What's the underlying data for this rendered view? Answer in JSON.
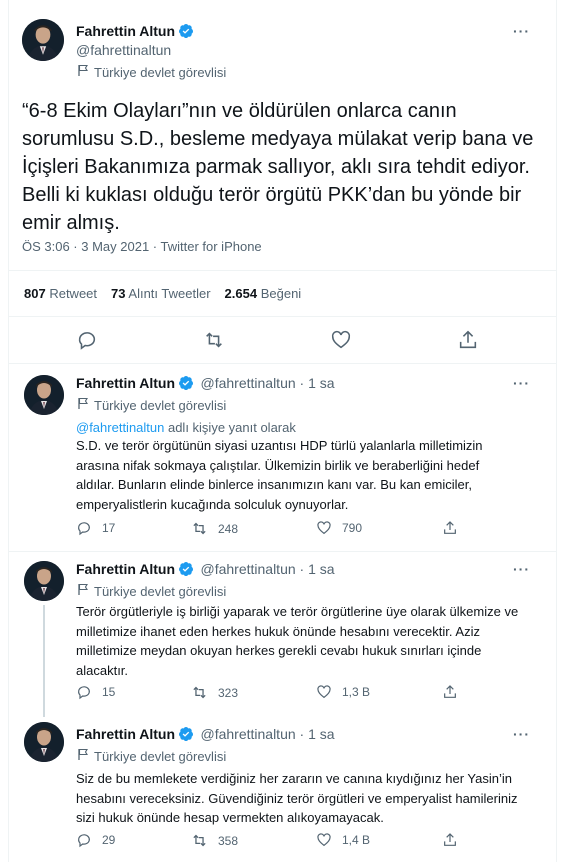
{
  "author": {
    "name": "Fahrettin Altun",
    "handle": "@fahrettinaltun",
    "label": "Türkiye devlet görevlisi"
  },
  "main_tweet": {
    "text": "“6-8 Ekim Olayları”nın ve öldürülen onlarca canın sorumlusu S.D., besleme medyaya mülakat verip bana ve İçişleri Bakanımıza parmak sallıyor, aklı sıra tehdit ediyor. Belli ki kuklası olduğu terör örgütü PKK’dan bu yönde bir emir almış.",
    "meta": "ÖS 3:06 · 3 May 2021 · Twitter for iPhone",
    "stats": {
      "retweets_count": "807",
      "retweets_label": "Retweet",
      "quotes_count": "73",
      "quotes_label": "Alıntı Tweetler",
      "likes_count": "2.654",
      "likes_label": "Beğeni"
    }
  },
  "replies": [
    {
      "time": " · 1 sa",
      "reply_to_link": "@fahrettinaltun",
      "reply_to_suffix": " adlı kişiye yanıt olarak",
      "text": "S.D. ve terör örgütünün siyasi uzantısı HDP türlü yalanlarla milletimizin arasına nifak sokmaya çalıştılar. Ülkemizin birlik ve beraberliğini hedef aldılar. Bunların elinde binlerce insanımızın kanı var. Bu kan emiciler, emperyalistlerin kucağında solculuk oynuyorlar.",
      "replies": "17",
      "retweets": "248",
      "likes": "790"
    },
    {
      "time": " · 1 sa",
      "text": "Terör örgütleriyle iş birliği yaparak ve terör örgütlerine üye olarak ülkemize ve milletimize ihanet eden herkes hukuk önünde hesabını verecektir. Aziz milletimize meydan okuyan herkes gerekli cevabı hukuk sınırları içinde alacaktır.",
      "replies": "15",
      "retweets": "323",
      "likes": "1,3 B"
    },
    {
      "time": " · 1 sa",
      "text": "Siz de bu memlekete verdiğiniz her zararın ve canına kıydığınız her Yasin’in hesabını vereceksiniz. Güvendiğiniz terör örgütleri ve emperyalist hamileriniz sizi hukuk önünde hesap vermekten alıkoyamayacak.",
      "replies": "29",
      "retweets": "358",
      "likes": "1,4 B"
    }
  ],
  "more_glyph": "···",
  "colors": {
    "accent": "#1d9bf0",
    "muted": "#536471",
    "text": "#0f1419",
    "line": "#cfd9de"
  }
}
